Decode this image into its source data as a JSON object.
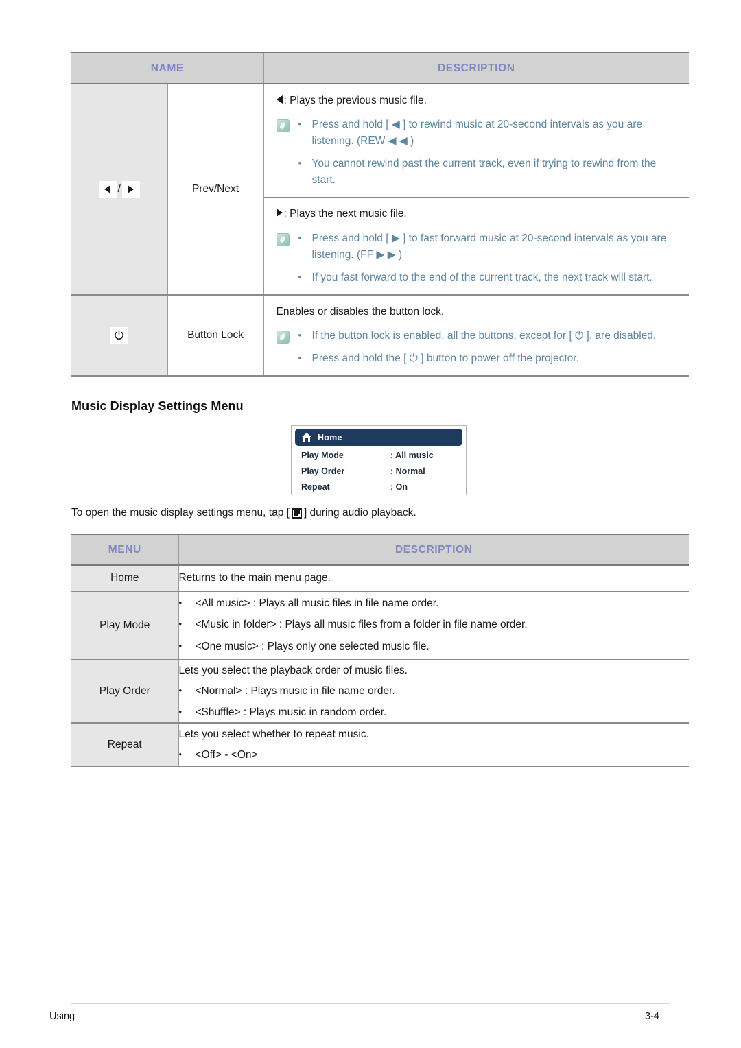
{
  "table1": {
    "headers": {
      "name": "NAME",
      "description": "DESCRIPTION"
    },
    "rows": [
      {
        "icon_name": "prev-next-icon",
        "label": "Prev/Next",
        "blocks": [
          {
            "plain": ": Plays the previous music file.",
            "plain_prefix_icon": "triangle-left-icon",
            "notes": [
              "Press and hold [ ◀ ] to rewind music at 20-second intervals as you are listening. (REW ◀ ◀ )",
              "You cannot rewind past the current track, even if trying to rewind from the start."
            ]
          },
          {
            "plain": ": Plays the next music file.",
            "plain_prefix_icon": "triangle-right-icon",
            "notes": [
              "Press and hold [ ▶ ] to fast forward music at 20-second intervals as you are listening. (FF ▶ ▶ )",
              "If you fast forward to the end of the current track, the next track will start."
            ]
          }
        ]
      },
      {
        "icon_name": "power-icon",
        "label": "Button Lock",
        "blocks": [
          {
            "plain": "Enables or disables the button lock.",
            "plain_prefix_icon": "",
            "notes": [
              "If the button lock is enabled, all the buttons, except for [ ⏻ ], are disabled.",
              "Press and hold the [ ⏻ ] button to power off the projector."
            ]
          }
        ]
      }
    ]
  },
  "section": {
    "title": "Music Display Settings Menu"
  },
  "osd": {
    "home_label": "Home",
    "rows": [
      {
        "key": "Play Mode",
        "value": ": All music"
      },
      {
        "key": "Play Order",
        "value": ": Normal"
      },
      {
        "key": "Repeat",
        "value": ": On"
      }
    ]
  },
  "intro": {
    "before": "To open the music display settings menu, tap [",
    "after": "] during audio playback."
  },
  "table2": {
    "headers": {
      "menu": "MENU",
      "description": "DESCRIPTION"
    },
    "rows": [
      {
        "name": "Home",
        "lead": "Returns to the main menu page.",
        "bullets": []
      },
      {
        "name": "Play Mode",
        "lead": "",
        "bullets": [
          "<All music> : Plays all music files in file name order.",
          "<Music in folder> : Plays all music files from a folder in file name order.",
          "<One music> : Plays only one selected music file."
        ]
      },
      {
        "name": "Play Order",
        "lead": "Lets you select the playback order of music files.",
        "bullets": [
          "<Normal> : Plays music in file name order.",
          "<Shuffle> : Plays music in random order."
        ]
      },
      {
        "name": "Repeat",
        "lead": "Lets you select whether to repeat music.",
        "bullets": [
          "<Off> - <On>"
        ]
      }
    ]
  },
  "footer": {
    "left": "Using",
    "right": "3-4"
  },
  "colors": {
    "header_bg": "#d2d2d2",
    "header_text": "#8286c0",
    "note_text": "#5d86a0",
    "name_cell_bg": "#e6e6e6",
    "osd_accent": "#1e3a5f"
  }
}
